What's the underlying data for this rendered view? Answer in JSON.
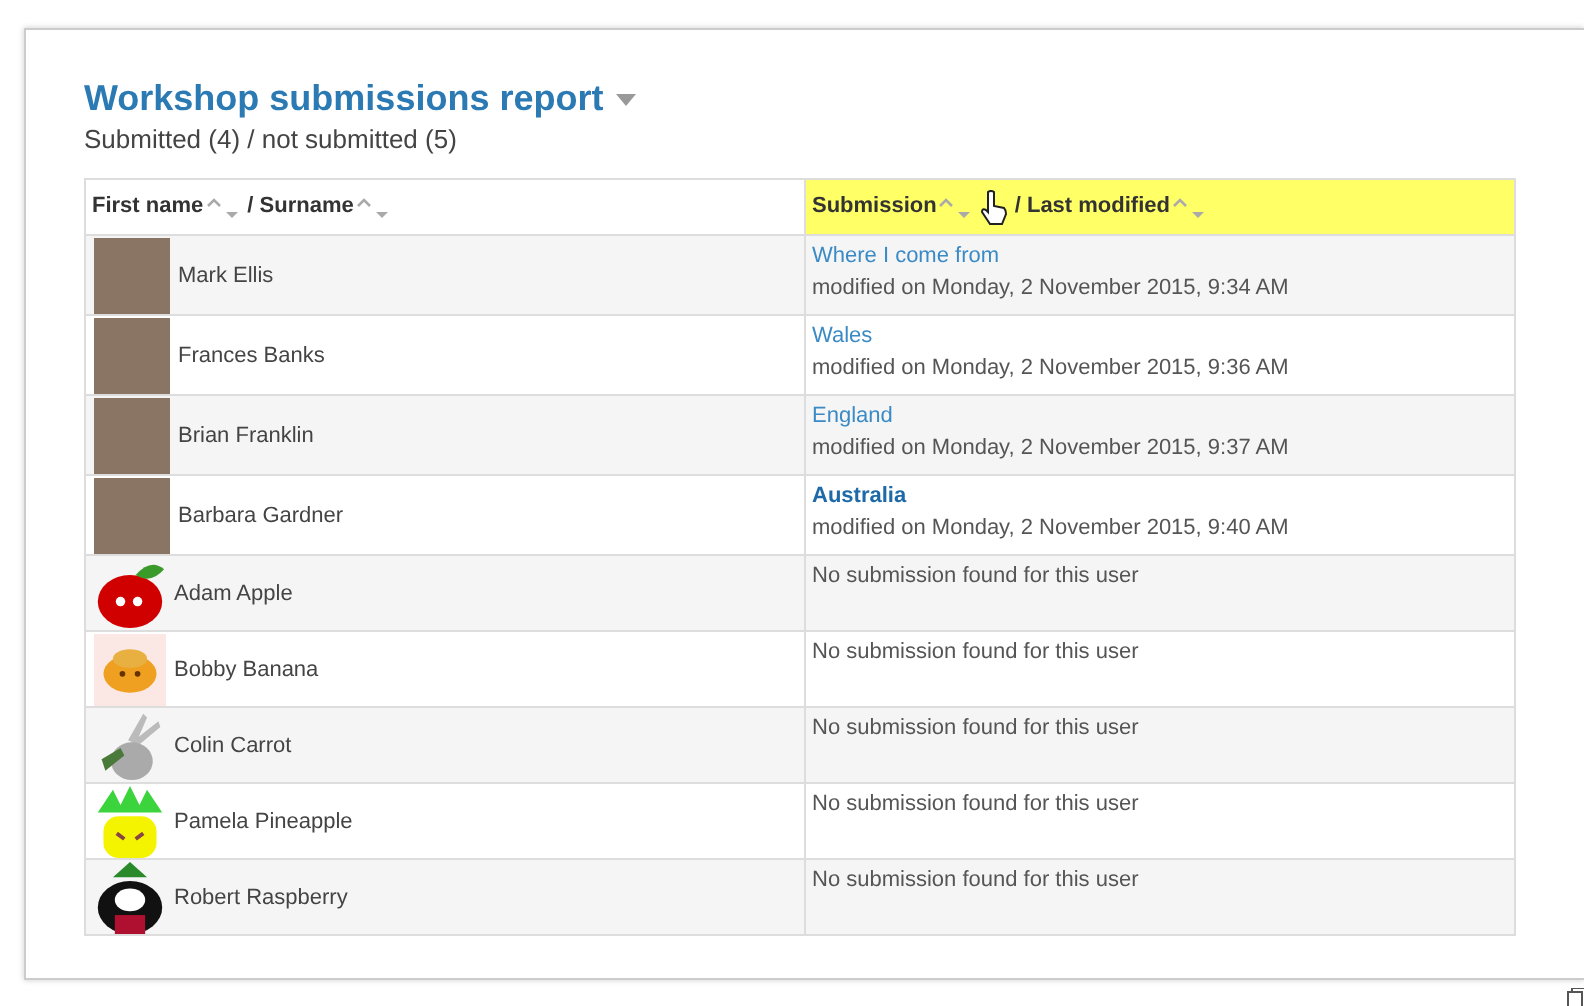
{
  "report": {
    "title": "Workshop submissions report",
    "summary": "Submitted (4) / not submitted (5)"
  },
  "table": {
    "columns": [
      {
        "separator": "/",
        "highlighted": false,
        "sorts": [
          {
            "label": "First name"
          },
          {
            "label": "Surname"
          }
        ]
      },
      {
        "separator": "/",
        "highlighted": true,
        "sorts": [
          {
            "label": "Submission"
          },
          {
            "label": "Last modified"
          }
        ]
      }
    ],
    "rows": [
      {
        "name": "Mark Ellis",
        "avatar": {
          "kind": "photo"
        },
        "submission": {
          "kind": "link",
          "title": "Where I come from",
          "highlighted": false,
          "modified": "modified on Monday, 2 November 2015, 9:34 AM"
        }
      },
      {
        "name": "Frances Banks",
        "avatar": {
          "kind": "photo"
        },
        "submission": {
          "kind": "link",
          "title": "Wales",
          "highlighted": false,
          "modified": "modified on Monday, 2 November 2015, 9:36 AM"
        }
      },
      {
        "name": "Brian Franklin",
        "avatar": {
          "kind": "photo"
        },
        "submission": {
          "kind": "link",
          "title": "England",
          "highlighted": false,
          "modified": "modified on Monday, 2 November 2015, 9:37 AM"
        }
      },
      {
        "name": "Barbara Gardner",
        "avatar": {
          "kind": "photo"
        },
        "submission": {
          "kind": "link",
          "title": "Australia",
          "highlighted": true,
          "modified": "modified on Monday, 2 November 2015, 9:40 AM"
        }
      },
      {
        "name": "Adam Apple",
        "avatar": {
          "kind": "apple"
        },
        "submission": {
          "kind": "none",
          "text": "No submission found for this user"
        }
      },
      {
        "name": "Bobby Banana",
        "avatar": {
          "kind": "banana"
        },
        "submission": {
          "kind": "none",
          "text": "No submission found for this user"
        }
      },
      {
        "name": "Colin Carrot",
        "avatar": {
          "kind": "rabbit"
        },
        "submission": {
          "kind": "none",
          "text": "No submission found for this user"
        }
      },
      {
        "name": "Pamela Pineapple",
        "avatar": {
          "kind": "pineapple"
        },
        "submission": {
          "kind": "none",
          "text": "No submission found for this user"
        }
      },
      {
        "name": "Robert Raspberry",
        "avatar": {
          "kind": "raspberry"
        },
        "submission": {
          "kind": "none",
          "text": "No submission found for this user"
        }
      }
    ]
  }
}
